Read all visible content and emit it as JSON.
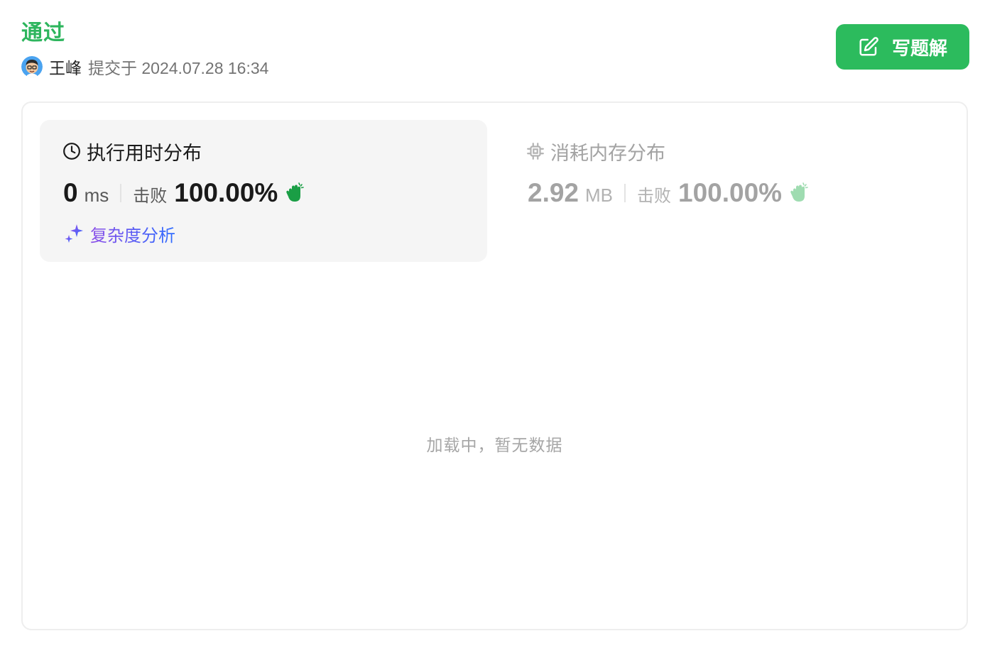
{
  "status": {
    "title": "通过",
    "color": "#2db55d"
  },
  "submission": {
    "username": "王峰",
    "submitted_text": "提交于 2024.07.28 16:34",
    "avatar_icon": "user-avatar"
  },
  "write_solution": {
    "label": "写题解",
    "icon": "edit-icon",
    "color": "#2cbb5d"
  },
  "runtime": {
    "title": "执行用时分布",
    "icon": "clock-icon",
    "value": "0",
    "unit": "ms",
    "beats_label": "击败",
    "beats_pct": "100.00%",
    "beats_icon": "clap-icon",
    "complexity_label": "复杂度分析",
    "complexity_icon": "sparkle-icon"
  },
  "memory": {
    "title": "消耗内存分布",
    "icon": "chip-icon",
    "value": "2.92",
    "unit": "MB",
    "beats_label": "击败",
    "beats_pct": "100.00%",
    "beats_icon": "clap-icon"
  },
  "chart_area": {
    "empty_message": "加载中，暂无数据"
  }
}
